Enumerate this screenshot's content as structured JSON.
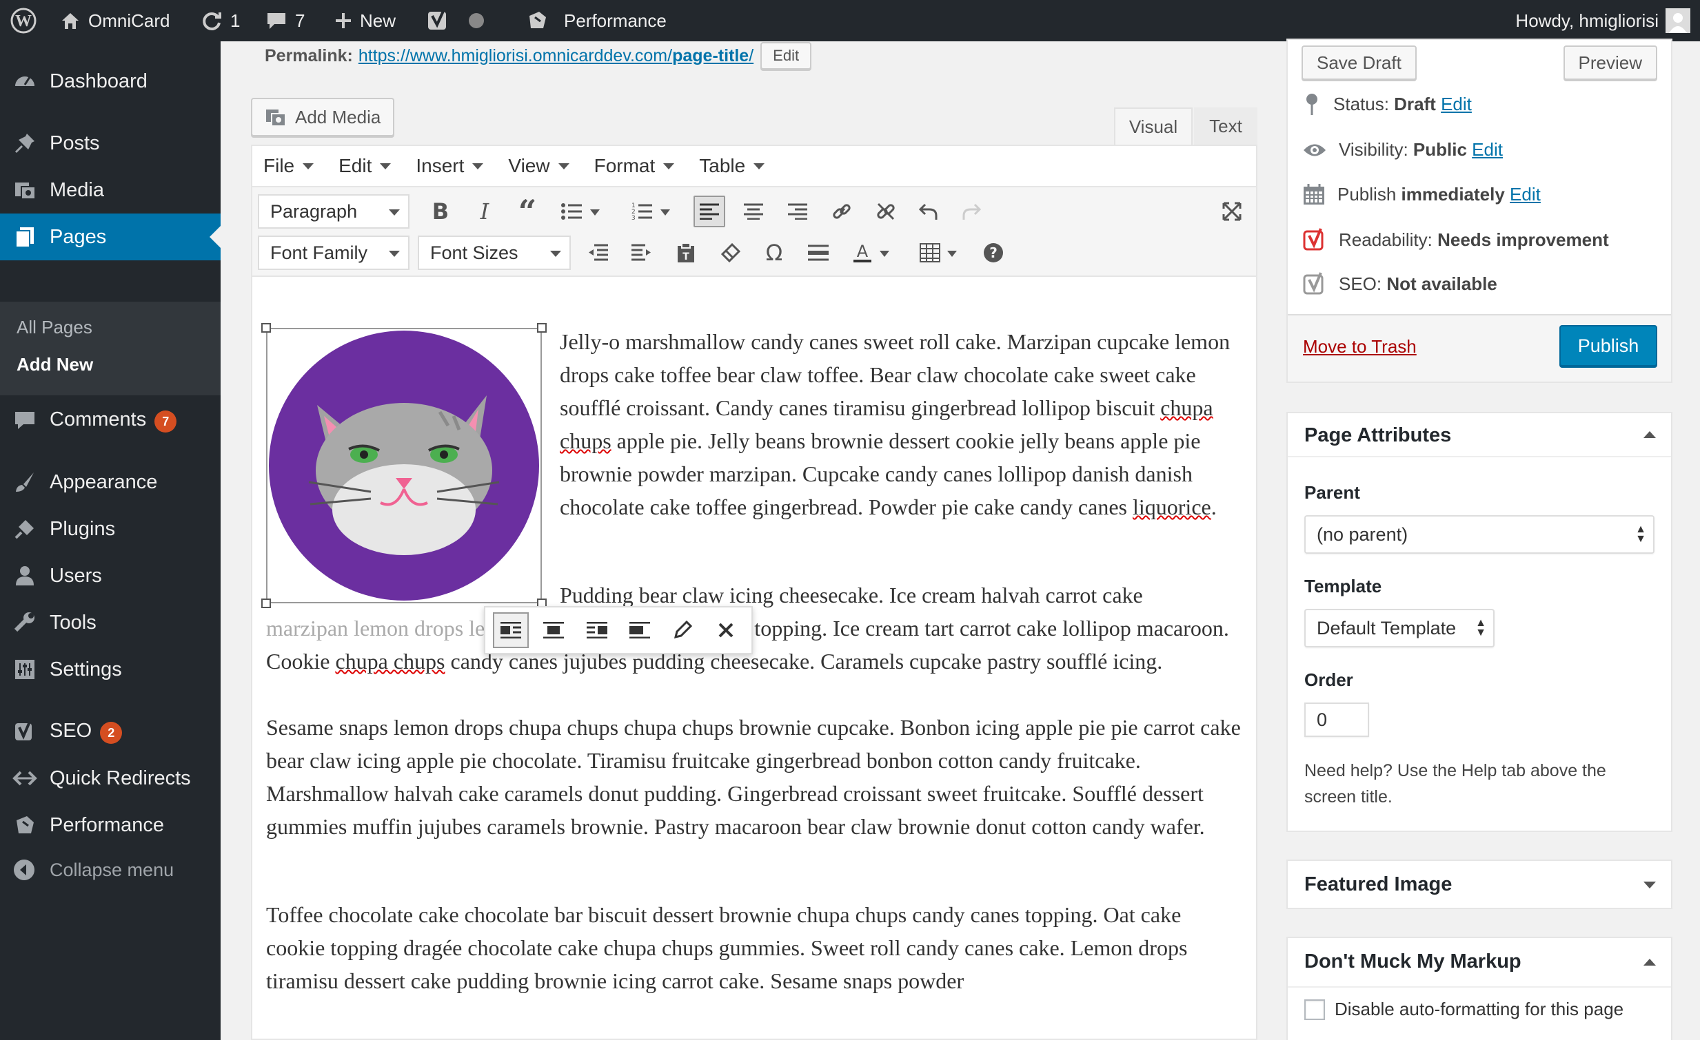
{
  "admin_bar": {
    "site_name": "OmniCard",
    "updates_count": "1",
    "comments_count": "7",
    "new_label": "New",
    "performance_label": "Performance",
    "howdy": "Howdy, hmigliorisi"
  },
  "sidebar": {
    "items": [
      {
        "label": "Dashboard"
      },
      {
        "label": "Posts"
      },
      {
        "label": "Media"
      },
      {
        "label": "Pages"
      },
      {
        "label": "Comments",
        "badge": "7"
      },
      {
        "label": "Appearance"
      },
      {
        "label": "Plugins"
      },
      {
        "label": "Users"
      },
      {
        "label": "Tools"
      },
      {
        "label": "Settings"
      },
      {
        "label": "SEO",
        "badge": "2"
      },
      {
        "label": "Quick Redirects"
      },
      {
        "label": "Performance"
      }
    ],
    "submenu": [
      "All Pages",
      "Add New"
    ],
    "collapse": "Collapse menu"
  },
  "editor": {
    "permalink_label": "Permalink:",
    "permalink_url_prefix": "https://www.hmigliorisi.omnicarddev.com/",
    "permalink_slug": "page-title",
    "permalink_suffix": "/",
    "edit_button": "Edit",
    "add_media": "Add Media",
    "tab_visual": "Visual",
    "tab_text": "Text",
    "menus": [
      "File",
      "Edit",
      "Insert",
      "View",
      "Format",
      "Table"
    ],
    "format_select": "Paragraph",
    "font_family": "Font Family",
    "font_sizes": "Font Sizes",
    "paragraphs": {
      "p1": "Jelly-o marshmallow candy canes sweet roll cake. Marzipan cupcake lemon drops cake toffee bear claw toffee. Bear claw chocolate cake sweet cake soufflé croissant. Candy canes tiramisu gingerbread lollipop biscuit",
      "p1_sp": "chupa chups",
      "p1_b": "apple pie. Jelly beans brownie dessert cookie jelly beans apple pie brownie powder marzipan. Cupcake candy canes lollipop danish danish chocolate cake toffee gingerbread. Powder pie cake candy canes",
      "p1_sp2": "liquorice",
      "p1_c": ".",
      "p2_first": "Pudding bear claw icing cheesecake. Ice cream halvah carrot cake",
      "p2_hidden": "marzipan lemon drops lemon",
      "p2_rest": "drops. Powder sweet roll topping. Ice cream tart carrot cake lollipop macaroon. Cookie",
      "p2_sp": "chupa chups",
      "p2_end": "candy canes jujubes pudding cheesecake. Caramels cupcake pastry soufflé icing.",
      "p3": "Sesame snaps lemon drops chupa chups chupa chups brownie cupcake. Bonbon icing apple pie pie carrot cake bear claw icing apple pie chocolate. Tiramisu fruitcake gingerbread bonbon cotton candy fruitcake. Marshmallow halvah cake caramels donut pudding. Gingerbread croissant sweet fruitcake. Soufflé dessert gummies muffin jujubes caramels brownie. Pastry macaroon bear claw brownie donut cotton candy wafer.",
      "p4": "Toffee chocolate cake chocolate bar biscuit dessert brownie chupa chups candy canes topping. Oat cake cookie topping dragée chocolate cake chupa chups gummies. Sweet roll candy canes cake. Lemon drops tiramisu dessert cake pudding brownie icing carrot cake. Sesame snaps powder"
    }
  },
  "publish": {
    "save_draft": "Save Draft",
    "preview": "Preview",
    "status_label": "Status:",
    "status_value": "Draft",
    "visibility_label": "Visibility:",
    "visibility_value": "Public",
    "publish_label": "Publish",
    "publish_value": "immediately",
    "readability_label": "Readability:",
    "readability_value": "Needs improvement",
    "seo_label": "SEO:",
    "seo_value": "Not available",
    "edit_link": "Edit",
    "trash": "Move to Trash",
    "publish_button": "Publish"
  },
  "page_attributes": {
    "title": "Page Attributes",
    "parent_label": "Parent",
    "parent_value": "(no parent)",
    "template_label": "Template",
    "template_value": "Default Template",
    "order_label": "Order",
    "order_value": "0",
    "help": "Need help? Use the Help tab above the screen title."
  },
  "featured_image": {
    "title": "Featured Image"
  },
  "markup": {
    "title": "Don't Muck My Markup",
    "checkbox_label": "Disable auto-formatting for this page"
  },
  "colors": {
    "accent": "#0073aa",
    "adminbar": "#23282d",
    "badge": "#d54e21",
    "cat_circle": "#6b2fa0"
  }
}
